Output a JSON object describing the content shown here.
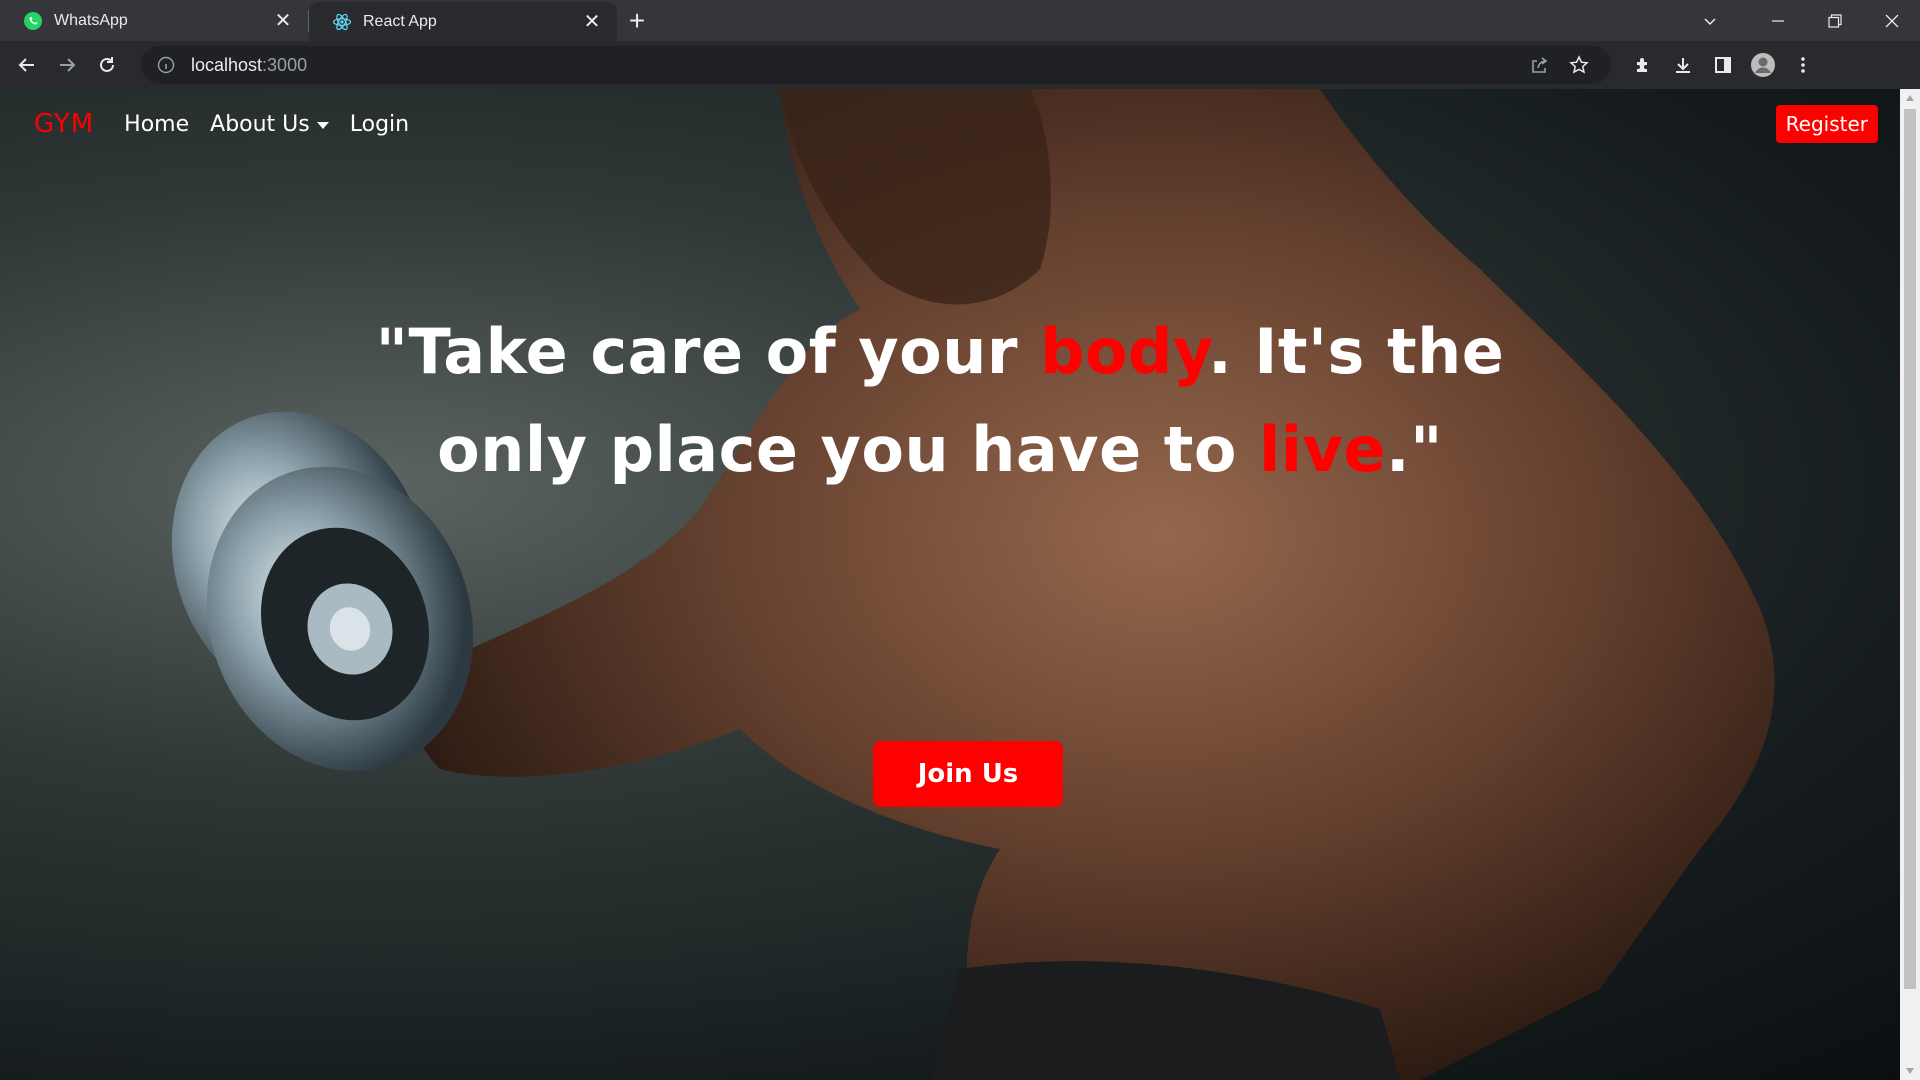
{
  "browser": {
    "tabs": [
      {
        "title": "WhatsApp",
        "icon": "whatsapp-icon",
        "active": false
      },
      {
        "title": "React App",
        "icon": "react-icon",
        "active": true
      }
    ],
    "address": {
      "host": "localhost",
      "port": ":3000"
    }
  },
  "navbar": {
    "brand": "GYM",
    "links": [
      {
        "label": "Home"
      },
      {
        "label": "About Us",
        "dropdown": true
      },
      {
        "label": "Login"
      }
    ],
    "register_label": "Register"
  },
  "hero": {
    "quote_part1": "\"Take care of your ",
    "quote_accent1": "body",
    "quote_part2": ". It's the only place you have to ",
    "quote_accent2": "live",
    "quote_part3": ".\"",
    "cta_label": "Join Us"
  },
  "colors": {
    "accent": "#ff0000",
    "chrome_dark": "#35363a",
    "toolbar": "#292a2d"
  }
}
